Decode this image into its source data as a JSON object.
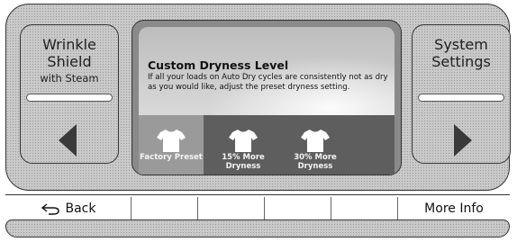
{
  "left_button": {
    "line1": "Wrinkle",
    "line2": "Shield",
    "line3": "with Steam"
  },
  "right_button": {
    "line1": "System",
    "line2": "Settings"
  },
  "screen": {
    "heading": "Custom Dryness Level",
    "description": "If all your loads on Auto Dry cycles are consistently not as dry as you would like, adjust the preset dryness setting.",
    "options": [
      {
        "line1": "Factory Preset",
        "line2": "",
        "selected": true
      },
      {
        "line1": "15% More",
        "line2": "Dryness",
        "selected": false
      },
      {
        "line1": "30% More",
        "line2": "Dryness",
        "selected": false
      }
    ]
  },
  "bottom_bar": {
    "back_label": "Back",
    "more_info_label": "More Info"
  }
}
